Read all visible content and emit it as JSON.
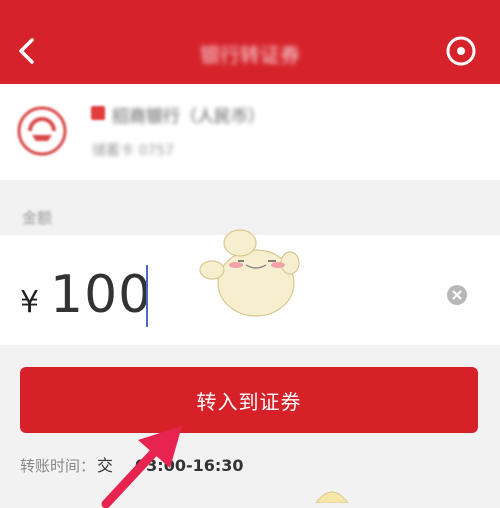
{
  "nav": {
    "title": "银行转证券"
  },
  "bank": {
    "name": "招商银行（人民币）",
    "account": "储蓄卡 0757"
  },
  "amount": {
    "label": "金额",
    "currency": "¥",
    "value": "100"
  },
  "transfer_button": "转入到证券",
  "time": {
    "label": "转账时间：",
    "text": "交",
    "value": "03:00-16:30"
  },
  "colors": {
    "brand_red": "#d6232b",
    "caret_blue": "#4a68c4"
  },
  "icons": [
    "back-icon",
    "more-icon",
    "bank-logo-icon",
    "clear-icon",
    "mascot-sticker",
    "pointer-arrow"
  ]
}
